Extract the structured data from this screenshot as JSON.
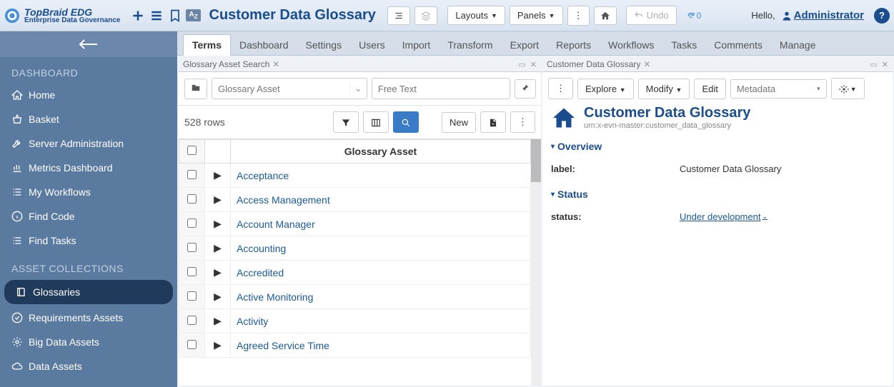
{
  "app": {
    "logo_title": "TopBraid EDG",
    "logo_subtitle": "Enterprise Data Governance",
    "page_title": "Customer Data Glossary",
    "layouts_label": "Layouts",
    "panels_label": "Panels",
    "undo_label": "Undo",
    "refresh_count": "0",
    "hello_label": "Hello,",
    "admin_label": "Administrator"
  },
  "sidebar": {
    "section1": "DASHBOARD",
    "items1": [
      {
        "label": "Home",
        "icon": "home"
      },
      {
        "label": "Basket",
        "icon": "basket"
      },
      {
        "label": "Server Administration",
        "icon": "wrench"
      },
      {
        "label": "Metrics Dashboard",
        "icon": "chart"
      },
      {
        "label": "My Workflows",
        "icon": "list"
      },
      {
        "label": "Find Code",
        "icon": "info"
      },
      {
        "label": "Find Tasks",
        "icon": "tasks"
      }
    ],
    "section2": "ASSET COLLECTIONS",
    "items2": [
      {
        "label": "Glossaries",
        "icon": "book",
        "active": true
      },
      {
        "label": "Requirements Assets",
        "icon": "check"
      },
      {
        "label": "Big Data Assets",
        "icon": "gear"
      },
      {
        "label": "Data Assets",
        "icon": "cloud"
      }
    ]
  },
  "tabs": [
    "Terms",
    "Dashboard",
    "Settings",
    "Users",
    "Import",
    "Transform",
    "Export",
    "Reports",
    "Workflows",
    "Tasks",
    "Comments",
    "Manage"
  ],
  "active_tab": 0,
  "left_panel": {
    "title": "Glossary Asset Search",
    "type_placeholder": "Glossary Asset",
    "free_text_placeholder": "Free Text",
    "row_count": "528 rows",
    "new_label": "New",
    "column_header": "Glossary Asset",
    "rows": [
      "Acceptance",
      "Access Management",
      "Account Manager",
      "Accounting",
      "Accredited",
      "Active Monitoring",
      "Activity",
      "Agreed Service Time"
    ]
  },
  "right_panel": {
    "tab_title": "Customer Data Glossary",
    "explore_label": "Explore",
    "modify_label": "Modify",
    "edit_label": "Edit",
    "metadata_label": "Metadata",
    "title": "Customer Data Glossary",
    "urn": "urn:x-evn-master:customer_data_glossary",
    "overview_header": "Overview",
    "label_key": "label:",
    "label_value": "Customer Data Glossary",
    "status_header": "Status",
    "status_key": "status:",
    "status_value": "Under development"
  }
}
